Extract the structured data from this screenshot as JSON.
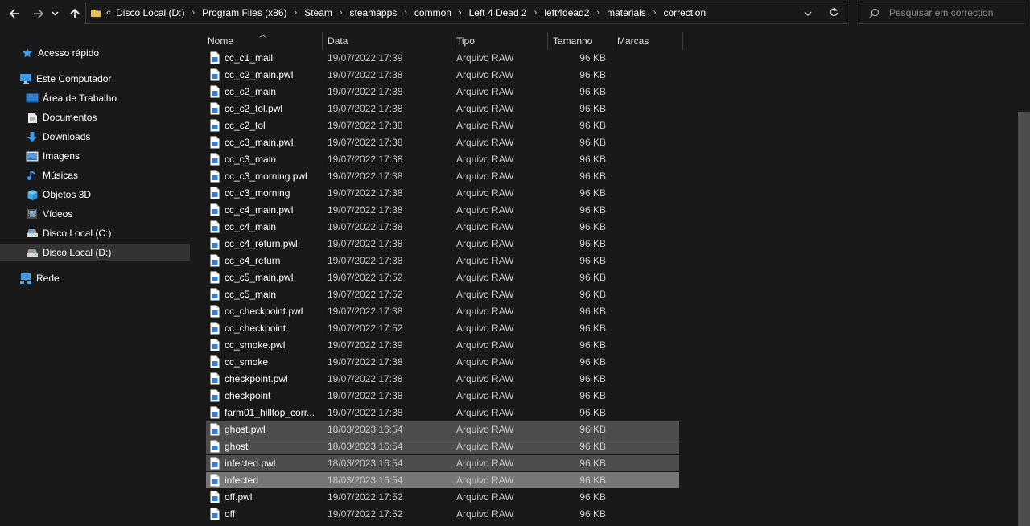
{
  "address": {
    "overflow": "«",
    "crumbs": [
      "Disco Local (D:)",
      "Program Files (x86)",
      "Steam",
      "steamapps",
      "common",
      "Left 4 Dead 2",
      "left4dead2",
      "materials",
      "correction"
    ]
  },
  "search": {
    "placeholder": "Pesquisar em correction"
  },
  "nav": {
    "items": [
      {
        "label": "Acesso rápido",
        "icon": "star-icon"
      },
      {
        "label": "Este Computador",
        "icon": "computer-icon"
      },
      {
        "label": "Área de Trabalho",
        "icon": "desktop-icon"
      },
      {
        "label": "Documentos",
        "icon": "documents-icon"
      },
      {
        "label": "Downloads",
        "icon": "download-arrow-icon"
      },
      {
        "label": "Imagens",
        "icon": "pictures-icon"
      },
      {
        "label": "Músicas",
        "icon": "music-note-icon"
      },
      {
        "label": "Objetos 3D",
        "icon": "cube-icon"
      },
      {
        "label": "Vídeos",
        "icon": "film-icon"
      },
      {
        "label": "Disco Local (C:)",
        "icon": "drive-icon"
      },
      {
        "label": "Disco Local (D:)",
        "icon": "drive-icon"
      },
      {
        "label": "Rede",
        "icon": "network-icon"
      }
    ]
  },
  "columns": {
    "name": "Nome",
    "date": "Data",
    "type": "Tipo",
    "size": "Tamanho",
    "tags": "Marcas"
  },
  "files": [
    {
      "name": "cc_c1_mall",
      "date": "19/07/2022 17:39",
      "type": "Arquivo RAW",
      "size": "96 KB"
    },
    {
      "name": "cc_c2_main.pwl",
      "date": "19/07/2022 17:38",
      "type": "Arquivo RAW",
      "size": "96 KB"
    },
    {
      "name": "cc_c2_main",
      "date": "19/07/2022 17:38",
      "type": "Arquivo RAW",
      "size": "96 KB"
    },
    {
      "name": "cc_c2_tol.pwl",
      "date": "19/07/2022 17:38",
      "type": "Arquivo RAW",
      "size": "96 KB"
    },
    {
      "name": "cc_c2_tol",
      "date": "19/07/2022 17:38",
      "type": "Arquivo RAW",
      "size": "96 KB"
    },
    {
      "name": "cc_c3_main.pwl",
      "date": "19/07/2022 17:38",
      "type": "Arquivo RAW",
      "size": "96 KB"
    },
    {
      "name": "cc_c3_main",
      "date": "19/07/2022 17:38",
      "type": "Arquivo RAW",
      "size": "96 KB"
    },
    {
      "name": "cc_c3_morning.pwl",
      "date": "19/07/2022 17:38",
      "type": "Arquivo RAW",
      "size": "96 KB"
    },
    {
      "name": "cc_c3_morning",
      "date": "19/07/2022 17:38",
      "type": "Arquivo RAW",
      "size": "96 KB"
    },
    {
      "name": "cc_c4_main.pwl",
      "date": "19/07/2022 17:38",
      "type": "Arquivo RAW",
      "size": "96 KB"
    },
    {
      "name": "cc_c4_main",
      "date": "19/07/2022 17:38",
      "type": "Arquivo RAW",
      "size": "96 KB"
    },
    {
      "name": "cc_c4_return.pwl",
      "date": "19/07/2022 17:38",
      "type": "Arquivo RAW",
      "size": "96 KB"
    },
    {
      "name": "cc_c4_return",
      "date": "19/07/2022 17:38",
      "type": "Arquivo RAW",
      "size": "96 KB"
    },
    {
      "name": "cc_c5_main.pwl",
      "date": "19/07/2022 17:52",
      "type": "Arquivo RAW",
      "size": "96 KB"
    },
    {
      "name": "cc_c5_main",
      "date": "19/07/2022 17:52",
      "type": "Arquivo RAW",
      "size": "96 KB"
    },
    {
      "name": "cc_checkpoint.pwl",
      "date": "19/07/2022 17:38",
      "type": "Arquivo RAW",
      "size": "96 KB"
    },
    {
      "name": "cc_checkpoint",
      "date": "19/07/2022 17:52",
      "type": "Arquivo RAW",
      "size": "96 KB"
    },
    {
      "name": "cc_smoke.pwl",
      "date": "19/07/2022 17:39",
      "type": "Arquivo RAW",
      "size": "96 KB"
    },
    {
      "name": "cc_smoke",
      "date": "19/07/2022 17:38",
      "type": "Arquivo RAW",
      "size": "96 KB"
    },
    {
      "name": "checkpoint.pwl",
      "date": "19/07/2022 17:38",
      "type": "Arquivo RAW",
      "size": "96 KB"
    },
    {
      "name": "checkpoint",
      "date": "19/07/2022 17:38",
      "type": "Arquivo RAW",
      "size": "96 KB"
    },
    {
      "name": "farm01_hilltop_corr...",
      "date": "19/07/2022 17:38",
      "type": "Arquivo RAW",
      "size": "96 KB"
    },
    {
      "name": "ghost.pwl",
      "date": "18/03/2023 16:54",
      "type": "Arquivo RAW",
      "size": "96 KB",
      "selected": true
    },
    {
      "name": "ghost",
      "date": "18/03/2023 16:54",
      "type": "Arquivo RAW",
      "size": "96 KB",
      "selected": true
    },
    {
      "name": "infected.pwl",
      "date": "18/03/2023 16:54",
      "type": "Arquivo RAW",
      "size": "96 KB",
      "selected": true
    },
    {
      "name": "infected",
      "date": "18/03/2023 16:54",
      "type": "Arquivo RAW",
      "size": "96 KB",
      "selected": true,
      "focused": true
    },
    {
      "name": "off.pwl",
      "date": "19/07/2022 17:52",
      "type": "Arquivo RAW",
      "size": "96 KB"
    },
    {
      "name": "off",
      "date": "19/07/2022 17:52",
      "type": "Arquivo RAW",
      "size": "96 KB"
    }
  ]
}
